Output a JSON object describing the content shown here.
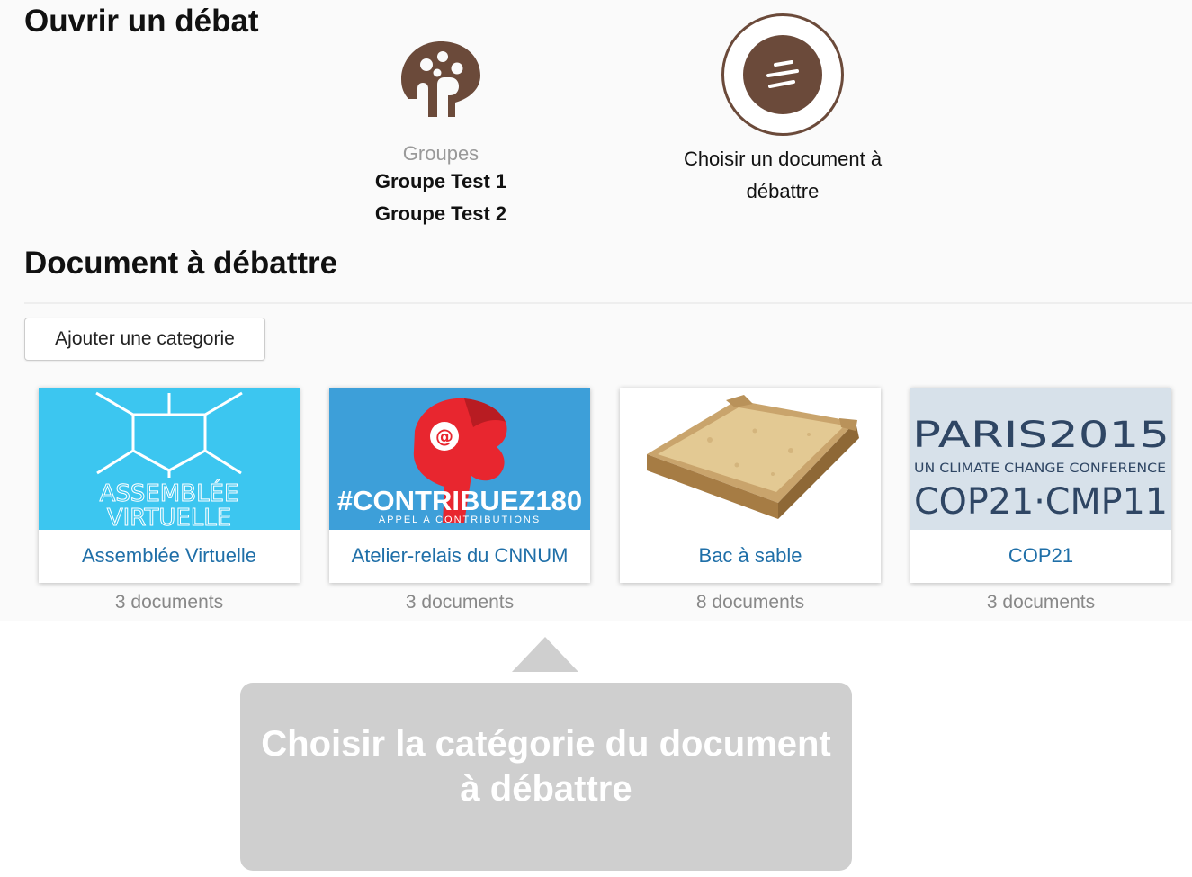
{
  "open_debate": {
    "title": "Ouvrir un débat",
    "groups_step": {
      "label": "Groupes",
      "groups": [
        "Groupe Test 1",
        "Groupe Test 2"
      ]
    },
    "document_step": {
      "label_line1": "Choisir un document à",
      "label_line2": "débattre"
    }
  },
  "document_section": {
    "title": "Document à débattre",
    "add_category_label": "Ajouter une categorie",
    "categories": [
      {
        "title": "Assemblée Virtuelle",
        "count": "3 documents",
        "thumb_text_1": "ASSEMBLÉE",
        "thumb_text_2": "VIRTUELLE"
      },
      {
        "title": "Atelier-relais du CNNUM",
        "count": "3 documents",
        "thumb_text_1": "#CONTRIBUEZ180",
        "thumb_text_2": "APPEL A CONTRIBUTIONS"
      },
      {
        "title": "Bac à sable",
        "count": "8 documents"
      },
      {
        "title": "COP21",
        "count": "3 documents",
        "thumb_text_1": "PARIS2015",
        "thumb_text_2": "UN CLIMATE CHANGE CONFERENCE",
        "thumb_text_3": "COP21·CMP11"
      }
    ]
  },
  "tooltip": {
    "line1": "Choisir la catégorie du document",
    "line2": "à débattre"
  },
  "colors": {
    "brand_brown": "#6b4a3a",
    "link_blue": "#1f6fa8",
    "tooltip_gray": "#cfcfcf",
    "assemblee_cyan": "#3cc6f0",
    "cnnum_blue": "#3d9fd9"
  },
  "icons": {
    "groups": "groups-logo-icon",
    "document": "document-choice-icon"
  }
}
